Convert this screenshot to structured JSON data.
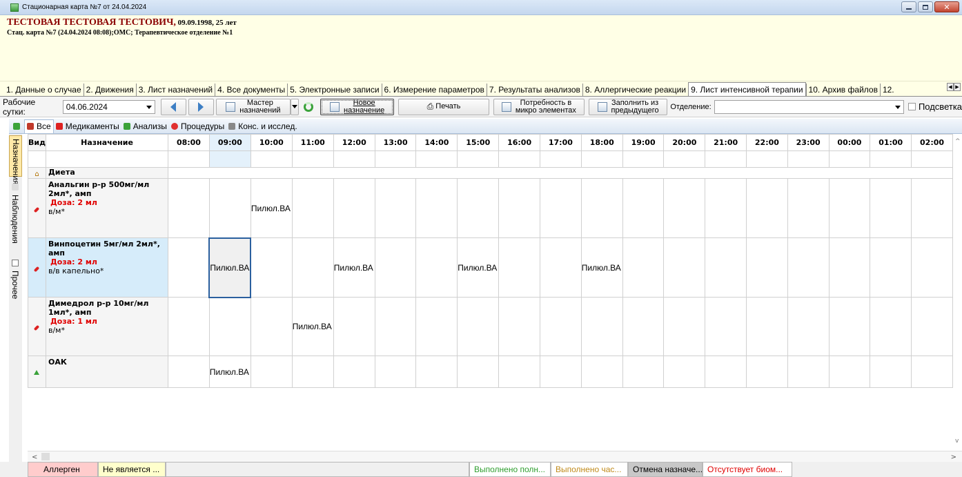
{
  "window": {
    "title": "Стационарная карта №7 от 24.04.2024"
  },
  "patient": {
    "name": "ТЕСТОВАЯ ТЕСТОВАЯ ТЕСТОВИЧ,",
    "birth": " 09.09.1998, 25 лет",
    "card": "Стац. карта №7 (24.04.2024 08:08);ОМС; Терапевтическое отделение №1"
  },
  "main_tabs": [
    "1. Данные о случае",
    "2. Движения",
    "3. Лист назначений",
    "4. Все документы",
    "5. Электронные записи",
    "6. Измерение параметров",
    "7. Результаты анализов",
    "8. Аллергические реакции",
    "9. Лист интенсивной терапии",
    "10. Архив файлов",
    "12."
  ],
  "toolbar": {
    "work_day_label": "Рабочие сутки:",
    "work_day_value": "04.06.2024",
    "master_line1": "Мастер",
    "master_line2": "назначений",
    "new_line1": "Новое",
    "new_line2": "назначение",
    "print_label": "Печать",
    "need_line1": "Потребность в",
    "need_line2": "микро элементах",
    "fill_line1": "Заполнить из",
    "fill_line2": "предыдущего",
    "dept_label": "Отделение:",
    "dept_value": "",
    "highlight_label": "Подсветка"
  },
  "sub_tabs": [
    "Все",
    "Медикаменты",
    "Анализы",
    "Процедуры",
    "Конс. и исслед."
  ],
  "side_tabs": [
    "Назначения",
    "Наблюдения",
    "Прочее"
  ],
  "grid": {
    "col_vid": "Вид",
    "col_nazn": "Назначение",
    "hours": [
      "08:00",
      "09:00",
      "10:00",
      "11:00",
      "12:00",
      "13:00",
      "14:00",
      "15:00",
      "16:00",
      "17:00",
      "18:00",
      "19:00",
      "20:00",
      "21:00",
      "22:00",
      "23:00",
      "00:00",
      "01:00",
      "02:00"
    ],
    "diet_label": "Диета",
    "rows": [
      {
        "name": "Анальгин р-р 500мг/мл 2мл*, амп",
        "dose": "Доза: 2 мл",
        "route": "в/м*",
        "marks": {
          "10:00": "Пилюл.ВА"
        }
      },
      {
        "name": "Винпоцетин 5мг/мл 2мл*, амп",
        "dose": "Доза: 2 мл",
        "route": "в/в капельно*",
        "marks": {
          "09:00": "Пилюл.ВА",
          "12:00": "Пилюл.ВА",
          "15:00": "Пилюл.ВА",
          "18:00": "Пилюл.ВА"
        }
      },
      {
        "name": "Димедрол р-р 10мг/мл 1мл*, амп",
        "dose": "Доза: 1 мл",
        "route": "в/м*",
        "marks": {
          "11:00": "Пилюл.ВА"
        }
      },
      {
        "name": "ОАК",
        "dose": "",
        "route": "",
        "marks": {
          "09:00": "Пилюл.ВА"
        }
      }
    ]
  },
  "legend": [
    {
      "label": "Аллерген",
      "bg": "#ffcccc",
      "fg": "#000000"
    },
    {
      "label": "Не является ...",
      "bg": "#ffffcc",
      "fg": "#000000"
    },
    {
      "label": "",
      "bg": "#f0f0f0",
      "fg": "#000000"
    },
    {
      "label": "Выполнено полн...",
      "bg": "#ffffff",
      "fg": "#2e9e2e"
    },
    {
      "label": "Выполнено час...",
      "bg": "#ffffff",
      "fg": "#c08a1a"
    },
    {
      "label": "Отмена назначе...",
      "bg": "#c8c8c8",
      "fg": "#000000"
    },
    {
      "label": "Отсутствует биом...",
      "bg": "#ffffff",
      "fg": "#e00000"
    }
  ],
  "colors": {
    "accent": "#3d7fc4",
    "dose": "#e00000",
    "header_bg": "#ffffe6",
    "selected_row": "#d6ecfa"
  }
}
